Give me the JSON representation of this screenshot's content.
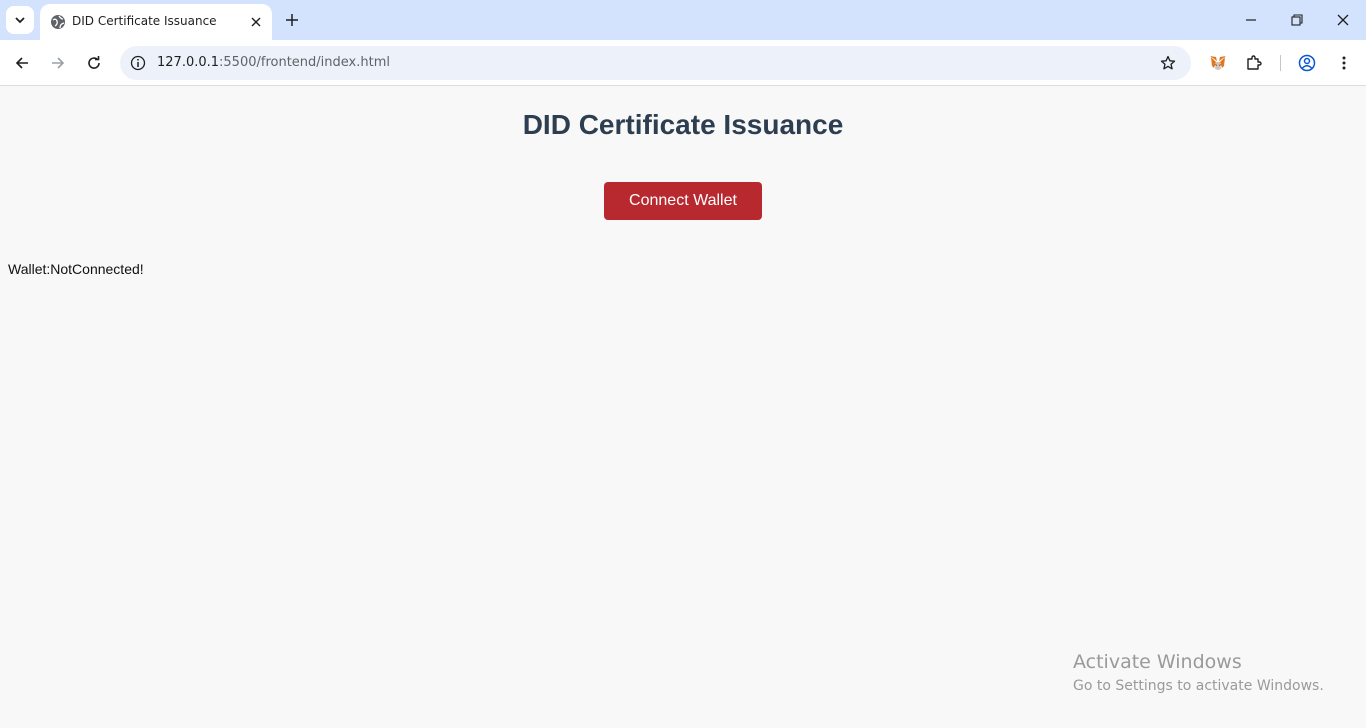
{
  "browser": {
    "tab": {
      "title": "DID Certificate Issuance",
      "favicon": "globe-icon"
    },
    "address": {
      "host": "127.0.0.1",
      "path": ":5500/frontend/index.html"
    },
    "colors": {
      "tabbar": "#d3e3fd",
      "omnibox": "#edf2fa"
    }
  },
  "page": {
    "title": "DID Certificate Issuance",
    "connect_button": "Connect Wallet",
    "wallet_status": "Wallet:NotConnected!",
    "colors": {
      "button": "#b8292f",
      "title": "#2c3e50",
      "background": "#f8f8f8"
    }
  },
  "watermark": {
    "line1": "Activate Windows",
    "line2": "Go to Settings to activate Windows."
  }
}
